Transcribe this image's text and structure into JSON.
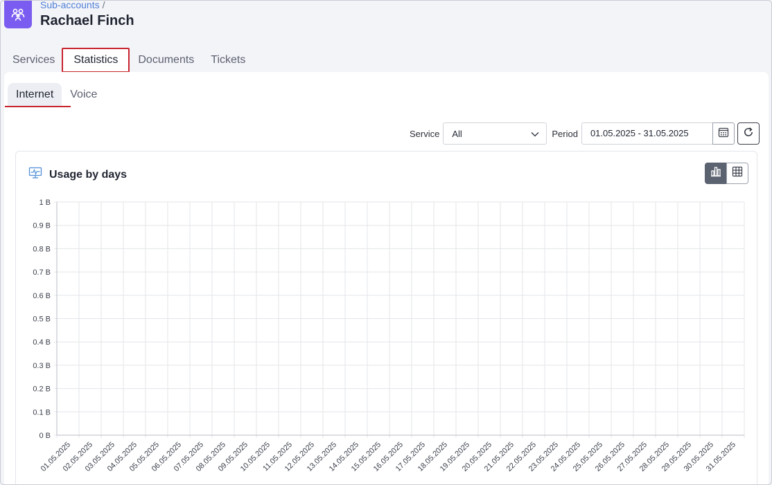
{
  "header": {
    "breadcrumb": "Sub-accounts",
    "breadcrumb_sep": "/",
    "title": "Rachael Finch",
    "app_icon": "users-icon"
  },
  "tabs": [
    {
      "label": "Services",
      "active": false
    },
    {
      "label": "Statistics",
      "active": true
    },
    {
      "label": "Documents",
      "active": false
    },
    {
      "label": "Tickets",
      "active": false
    }
  ],
  "subtabs": [
    {
      "label": "Internet",
      "active": true
    },
    {
      "label": "Voice",
      "active": false
    }
  ],
  "filters": {
    "service_label": "Service",
    "service_value": "All",
    "period_label": "Period",
    "period_value": "01.05.2025 - 31.05.2025"
  },
  "card": {
    "title": "Usage by days",
    "icon": "monitor-pulse-icon",
    "view_chart_icon": "bar-chart-icon",
    "view_table_icon": "table-grid-icon"
  },
  "colors": {
    "accent": "#7b5cf0",
    "active_outline": "#c8232c",
    "toggle_active": "#5b6270",
    "link": "#4f7fd6"
  },
  "chart_data": {
    "type": "bar",
    "title": "Usage by days",
    "y_ticks": [
      "0 B",
      "0.1 B",
      "0.2 B",
      "0.3 B",
      "0.4 B",
      "0.5 B",
      "0.6 B",
      "0.7 B",
      "0.8 B",
      "0.9 B",
      "1 B"
    ],
    "ylim": [
      0,
      1
    ],
    "grid": true,
    "categories": [
      "01.05.2025",
      "02.05.2025",
      "03.05.2025",
      "04.05.2025",
      "05.05.2025",
      "06.05.2025",
      "07.05.2025",
      "08.05.2025",
      "09.05.2025",
      "10.05.2025",
      "11.05.2025",
      "12.05.2025",
      "13.05.2025",
      "14.05.2025",
      "15.05.2025",
      "16.05.2025",
      "17.05.2025",
      "18.05.2025",
      "19.05.2025",
      "20.05.2025",
      "21.05.2025",
      "22.05.2025",
      "23.05.2025",
      "24.05.2025",
      "25.05.2025",
      "26.05.2025",
      "27.05.2025",
      "28.05.2025",
      "29.05.2025",
      "30.05.2025",
      "31.05.2025"
    ],
    "values": [
      0,
      0,
      0,
      0,
      0,
      0,
      0,
      0,
      0,
      0,
      0,
      0,
      0,
      0,
      0,
      0,
      0,
      0,
      0,
      0,
      0,
      0,
      0,
      0,
      0,
      0,
      0,
      0,
      0,
      0,
      0
    ]
  }
}
